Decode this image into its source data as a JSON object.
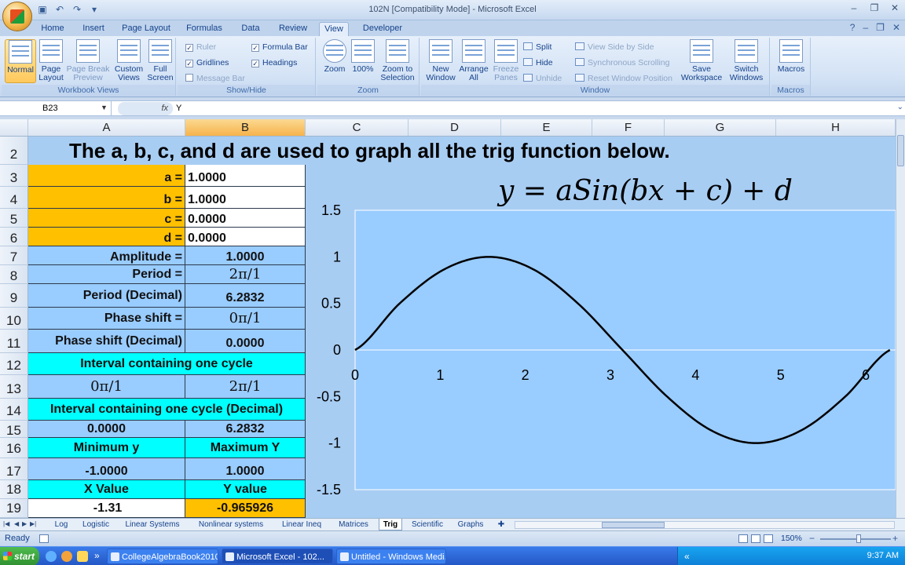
{
  "window": {
    "title": "102N  [Compatibility Mode] - Microsoft Excel",
    "name_box": "B23",
    "fx_label": "fx",
    "formula": "Y"
  },
  "ribbon_tabs": [
    "Home",
    "Insert",
    "Page Layout",
    "Formulas",
    "Data",
    "Review",
    "View",
    "Developer"
  ],
  "active_tab": "View",
  "ribbon": {
    "workbook_views": {
      "label": "Workbook Views",
      "buttons": [
        "Normal",
        "Page Layout",
        "Page Break Preview",
        "Custom Views",
        "Full Screen"
      ]
    },
    "show_hide": {
      "label": "Show/Hide",
      "ruler": "Ruler",
      "gridlines": "Gridlines",
      "message_bar": "Message Bar",
      "formula_bar": "Formula Bar",
      "headings": "Headings"
    },
    "zoom": {
      "label": "Zoom",
      "zoom": "Zoom",
      "hundred": "100%",
      "zoom_to_selection": "Zoom to Selection"
    },
    "window_group": {
      "label": "Window",
      "new_window": "New Window",
      "arrange_all": "Arrange All",
      "freeze_panes": "Freeze Panes",
      "split": "Split",
      "hide": "Hide",
      "unhide": "Unhide",
      "side_by_side": "View Side by Side",
      "sync_scroll": "Synchronous Scrolling",
      "reset_pos": "Reset Window Position",
      "save_workspace": "Save Workspace",
      "switch_windows": "Switch Windows"
    },
    "macros": {
      "label": "Macros",
      "macros": "Macros"
    }
  },
  "columns": [
    "A",
    "B",
    "C",
    "D",
    "E",
    "F",
    "G",
    "H"
  ],
  "rows": [
    "2",
    "3",
    "4",
    "5",
    "6",
    "7",
    "8",
    "9",
    "10",
    "11",
    "12",
    "13",
    "14",
    "15",
    "16",
    "17",
    "18",
    "19"
  ],
  "sheet": {
    "title": "The a, b, c, and d are used to graph all the trig function below.",
    "a_label": "a =",
    "a_value": "1.0000",
    "b_label": "b =",
    "b_value": "1.0000",
    "c_label": "c =",
    "c_value": "0.0000",
    "d_label": "d =",
    "d_value": "0.0000",
    "amplitude_label": "Amplitude =",
    "amplitude_value": "1.0000",
    "period_label": "Period =",
    "period_value": "2π/1",
    "period_dec_label": "Period (Decimal)",
    "period_dec_value": "6.2832",
    "phase_label": "Phase shift =",
    "phase_value": "0π/1",
    "phase_dec_label": "Phase shift (Decimal)",
    "phase_dec_value": "0.0000",
    "interval_label": "Interval containing one cycle",
    "interval_start": "0π/1",
    "interval_end": "2π/1",
    "interval_dec_label": "Interval containing one cycle (Decimal)",
    "interval_dec_start": "0.0000",
    "interval_dec_end": "6.2832",
    "min_y_label": "Minimum y",
    "max_y_label": "Maximum Y",
    "min_y_value": "-1.0000",
    "max_y_value": "1.0000",
    "x_value_label": "X Value",
    "y_value_label": "Y value",
    "x_value": "-1.31",
    "y_value": "-0.965926"
  },
  "chart_data": {
    "type": "line",
    "title": "y = aSin(bx + c) + d",
    "xlabel": "",
    "ylabel": "",
    "xlim": [
      0,
      6.2832
    ],
    "ylim": [
      -1.5,
      1.5
    ],
    "x_ticks": [
      "0",
      "1",
      "2",
      "3",
      "4",
      "5",
      "6"
    ],
    "y_ticks": [
      "1.5",
      "1",
      "0.5",
      "0",
      "-0.5",
      "-1",
      "-1.5"
    ],
    "grid": false,
    "series": [
      {
        "x": [
          0,
          0.5236,
          1.0472,
          1.5708,
          2.0944,
          2.618,
          3.1416,
          3.6652,
          4.1888,
          4.7124,
          5.236,
          5.7596,
          6.2832
        ],
        "y": [
          0,
          0.5,
          0.866,
          1,
          0.866,
          0.5,
          0,
          -0.5,
          -0.866,
          -1,
          -0.866,
          -0.5,
          0
        ]
      }
    ]
  },
  "sheet_tabs": [
    "Log",
    "Logistic",
    "Linear Systems",
    "Nonlinear systems",
    "Linear Ineq",
    "Matrices",
    "Trig",
    "Scientific",
    "Graphs"
  ],
  "active_sheet": "Trig",
  "status": {
    "ready": "Ready",
    "zoom": "150%"
  },
  "taskbar": {
    "start": "start",
    "items": [
      "CollegeAlgebraBook2010....",
      "Microsoft Excel - 102...",
      "Untitled - Windows Medi..."
    ],
    "clock": "9:37 AM"
  }
}
